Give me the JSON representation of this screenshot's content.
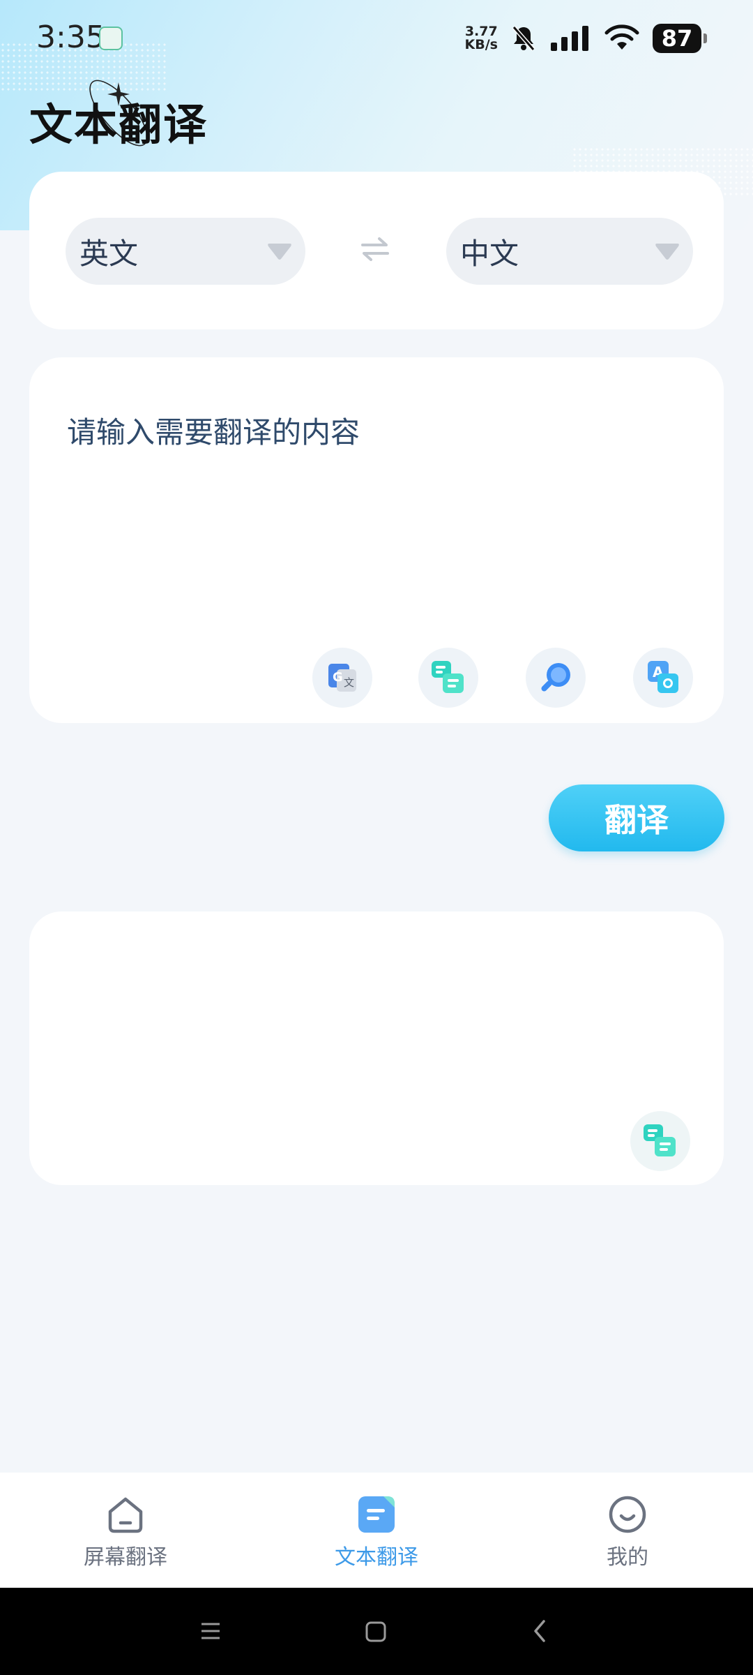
{
  "status": {
    "time": "3:35",
    "net_speed_value": "3.77",
    "net_speed_unit": "KB/s",
    "battery": "87"
  },
  "page": {
    "title": "文本翻译"
  },
  "languages": {
    "source": "英文",
    "target": "中文"
  },
  "input": {
    "placeholder": "请输入需要翻译的内容"
  },
  "actions": {
    "translate_label": "翻译"
  },
  "nav": {
    "items": [
      {
        "label": "屏幕翻译",
        "icon": "home-icon",
        "active": false
      },
      {
        "label": "文本翻译",
        "icon": "document-icon",
        "active": true
      },
      {
        "label": "我的",
        "icon": "profile-icon",
        "active": false
      }
    ]
  },
  "colors": {
    "accent": "#22b9ee",
    "nav_active": "#3d9ae8",
    "background": "#f3f6fa"
  }
}
